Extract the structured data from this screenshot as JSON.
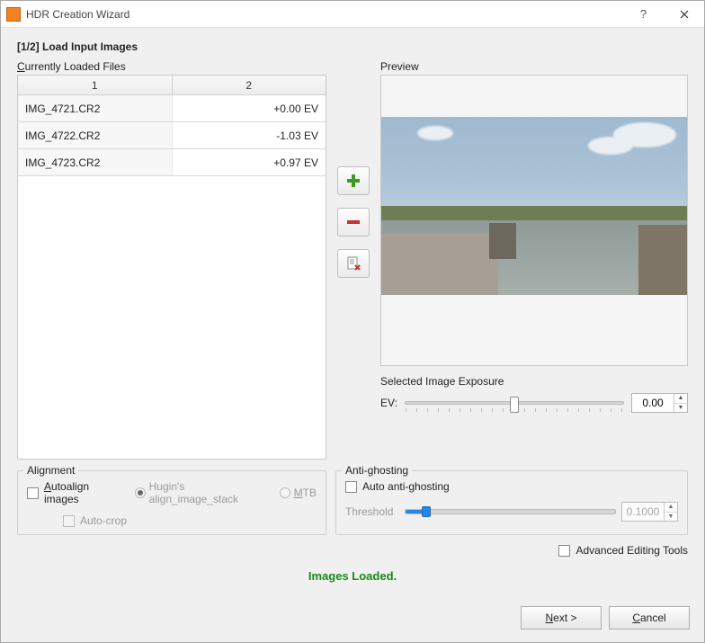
{
  "window": {
    "title": "HDR Creation Wizard"
  },
  "step": {
    "label": "[1/2] Load Input Images"
  },
  "files": {
    "label": "Currently Loaded Files",
    "headers": [
      "1",
      "2"
    ],
    "rows": [
      {
        "name": "IMG_4721.CR2",
        "ev": "+0.00 EV"
      },
      {
        "name": "IMG_4722.CR2",
        "ev": "-1.03 EV"
      },
      {
        "name": "IMG_4723.CR2",
        "ev": "+0.97 EV"
      }
    ]
  },
  "preview": {
    "label": "Preview"
  },
  "exposure": {
    "label": "Selected Image Exposure",
    "field_label": "EV:",
    "value": "0.00"
  },
  "alignment": {
    "legend": "Alignment",
    "autoalign": "Autoalign images",
    "hugin": "Hugin's align_image_stack",
    "mtb": "MTB",
    "autocrop": "Auto-crop"
  },
  "antighost": {
    "legend": "Anti-ghosting",
    "auto": "Auto anti-ghosting",
    "threshold_label": "Threshold",
    "threshold_value": "0.1000"
  },
  "advanced": {
    "label": "Advanced Editing Tools"
  },
  "status": {
    "message": "Images Loaded."
  },
  "buttons": {
    "next": "Next >",
    "cancel": "Cancel"
  }
}
